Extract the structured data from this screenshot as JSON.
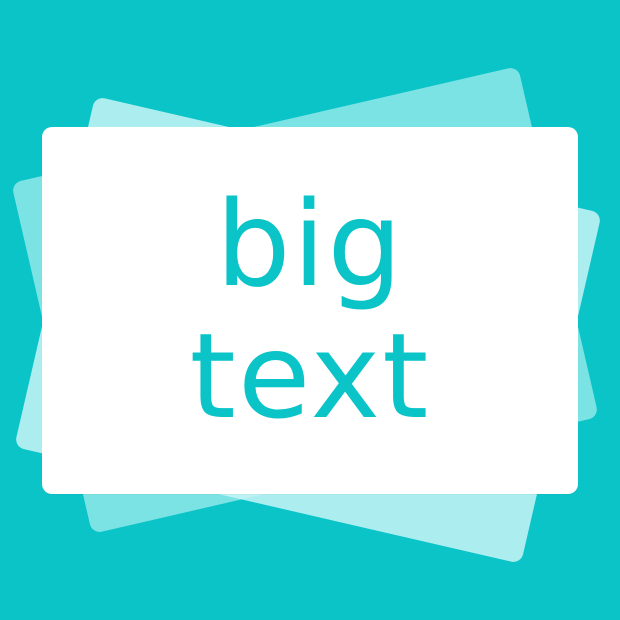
{
  "app_icon": {
    "name": "big text",
    "lines": [
      "big",
      "text"
    ]
  },
  "colors": {
    "background": "#0ac4c8",
    "text": "#0ac4c8",
    "front_card": "#ffffff",
    "back_cards": [
      "#a9eef0",
      "#c9f6f7"
    ]
  }
}
